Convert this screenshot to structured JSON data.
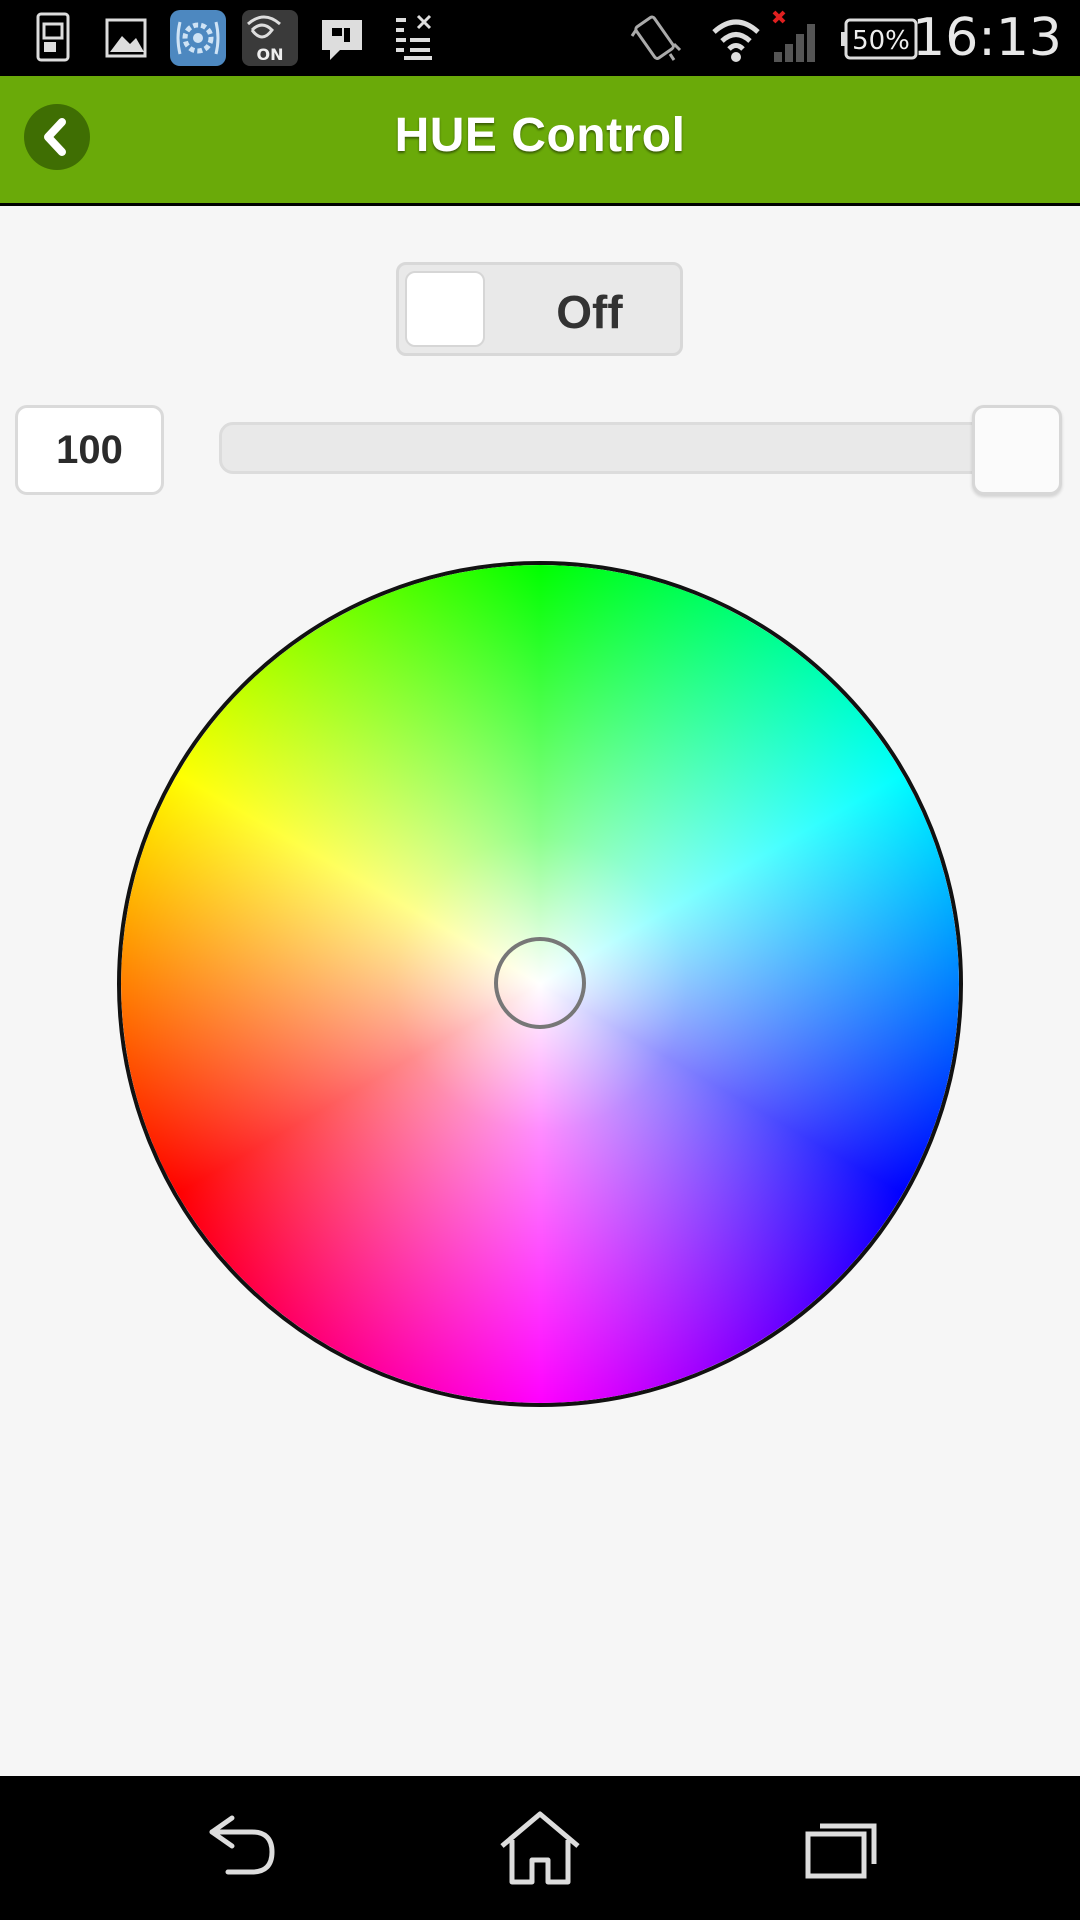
{
  "status_bar": {
    "time": "16:13",
    "battery": "50%",
    "icons": [
      "screenshot-icon",
      "gallery-icon",
      "settings-app-icon",
      "nfc-on-icon",
      "message-icon",
      "download-list-icon",
      "vibrate-icon",
      "wifi-icon",
      "signal-icon",
      "battery-icon"
    ],
    "nfc_badge": "ON"
  },
  "action_bar": {
    "title": "HUE Control",
    "color": "#6aaa09"
  },
  "toggle": {
    "label": "Off",
    "state": "off"
  },
  "brightness": {
    "value": "100",
    "level_fraction": 1.0
  },
  "color_wheel": {
    "selected": "center"
  },
  "nav_bar": {
    "buttons": [
      "back-icon",
      "home-icon",
      "recents-icon"
    ]
  }
}
